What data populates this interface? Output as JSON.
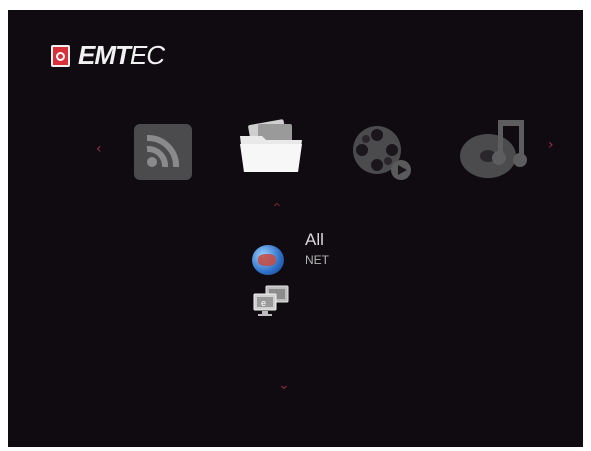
{
  "brand": {
    "logo_text_bold": "EMT",
    "logo_text_light": "EC"
  },
  "nav_arrows": {
    "left": "‹",
    "right": "›",
    "up": "⌃",
    "down": "⌄"
  },
  "carousel": {
    "items": [
      {
        "name": "rss-feeds",
        "icon": "rss-icon"
      },
      {
        "name": "files",
        "icon": "folder-icon",
        "selected": true
      },
      {
        "name": "movies",
        "icon": "film-reel-icon"
      },
      {
        "name": "music",
        "icon": "music-disc-icon"
      }
    ]
  },
  "list": {
    "items": [
      {
        "label": "All",
        "sublabel": "NET",
        "icon": "globe-icon",
        "selected": true
      },
      {
        "label": "",
        "icon": "network-computers-icon"
      }
    ]
  },
  "colors": {
    "background": "#0f0b10",
    "accent_arrow": "#a02d48",
    "logo_red": "#d8313a"
  }
}
